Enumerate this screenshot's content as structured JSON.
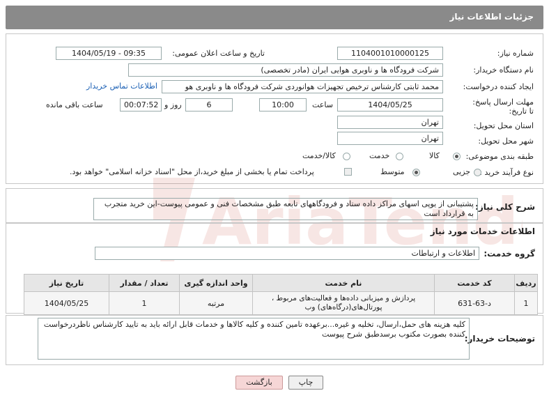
{
  "header": {
    "title": "جزئیات اطلاعات نیاز"
  },
  "fields": {
    "need_number_label": "شماره نیاز:",
    "need_number": "1104001010000125",
    "announce_label": "تاریخ و ساعت اعلان عمومی:",
    "announce_value": "1404/05/19 - 09:35",
    "buyer_org_label": "نام دستگاه خریدار:",
    "buyer_org": "شرکت فرودگاه ها و ناوبری هوایی ایران (مادر تخصصی)",
    "creator_label": "ایجاد کننده درخواست:",
    "creator": "محمد ثابتی کارشناس ترخیص تجهیزات هوانوردی شرکت فرودگاه ها و ناوبری هو",
    "contact_link": "اطلاعات تماس خریدار",
    "deadline_label": "مهلت ارسال پاسخ: تا تاریخ:",
    "deadline_date": "1404/05/25",
    "time_label": "ساعت",
    "deadline_time": "10:00",
    "days_value": "6",
    "days_label": "روز و",
    "remaining_time": "00:07:52",
    "remaining_label": "ساعت باقی مانده",
    "province_label": "استان محل تحویل:",
    "province": "تهران",
    "city_label": "شهر محل تحویل:",
    "city": "تهران",
    "category_label": "طبقه بندی موضوعی:",
    "category_options": [
      "کالا",
      "خدمت",
      "کالا/خدمت"
    ],
    "process_label": "نوع فرآیند خرید :",
    "process_options": [
      "جزیی",
      "متوسط"
    ],
    "payment_note": "پرداخت تمام یا بخشی از مبلغ خرید،از محل \"اسناد خزانه اسلامی\" خواهد بود."
  },
  "summary": {
    "label": "شرح کلی نیاز:",
    "text": "پشتیبانی از یوپی اسهای مراکز داده ستاد و فرودگاههای تابعه طبق مشخصات فنی و عمومی پیوست-این خرید متجرب به قرارداد است"
  },
  "services": {
    "section_title": "اطلاعات خدمات مورد نیاز",
    "group_label": "گروه خدمت:",
    "group_value": "اطلاعات و ارتباطات",
    "columns": [
      "ردیف",
      "کد خدمت",
      "نام خدمت",
      "واحد اندازه گیری",
      "تعداد / مقدار",
      "تاریخ نیاز"
    ],
    "rows": [
      {
        "row": "1",
        "code": "د-63-631",
        "name": "پردازش و میزبانی داده‌ها و فعالیت‌های مربوط ، پورتال‌های(درگاه‌های) وب",
        "unit": "مرتبه",
        "qty": "1",
        "date": "1404/05/25"
      }
    ]
  },
  "buyer_notes": {
    "label": "توضیحات خریدار:",
    "text": "کلیه هزینه های حمل،ارسال، تخلیه و غیره...برعهده تامین کننده و کلیه کالاها و خدمات قابل ارائه باید به تایید کارشناس ناظردرخواست کننده بصورت مکتوب برسدطبق شرح پیوست"
  },
  "buttons": {
    "print": "چاپ",
    "back": "بازگشت"
  },
  "watermark_text": "AriaTender.neT",
  "colors": {
    "header_bg": "#8a8a8a",
    "link": "#1a5fb4",
    "back_button_bg": "#f6d6d6",
    "watermark": "#c0392b"
  }
}
